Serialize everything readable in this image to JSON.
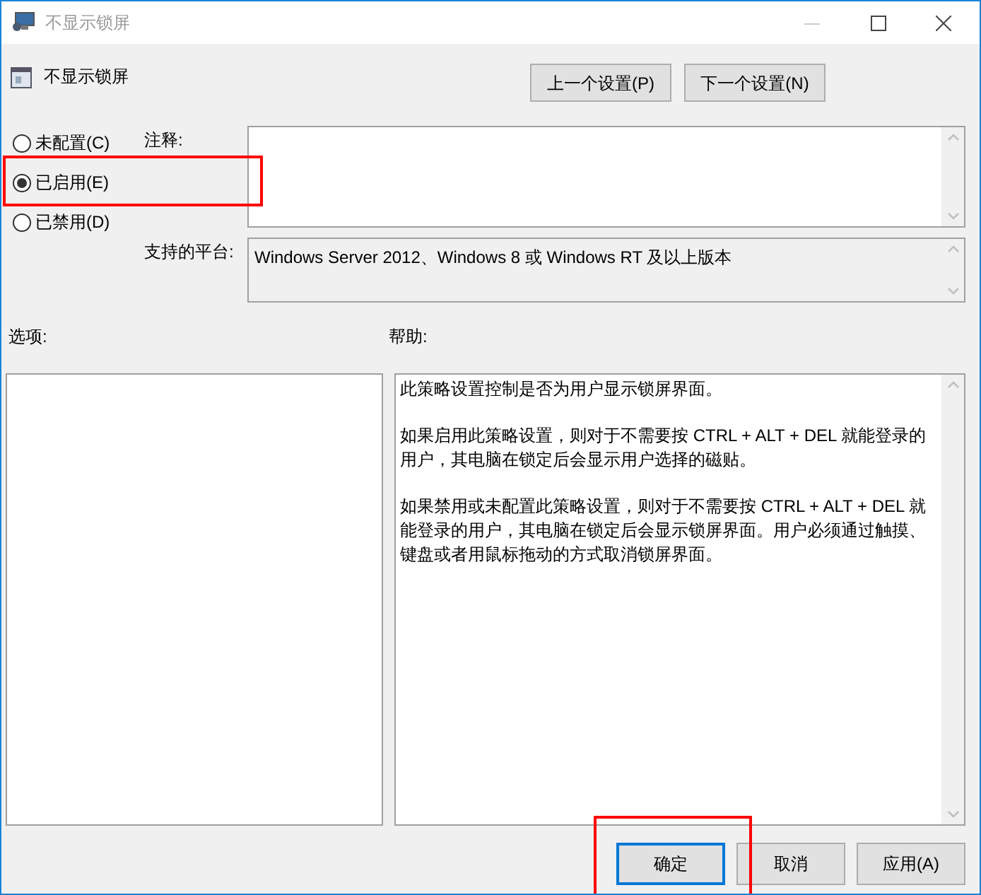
{
  "window": {
    "title": "不显示锁屏"
  },
  "policy_name": "不显示锁屏",
  "nav_buttons": [
    "上一个设置(P)",
    "下一个设置(N)"
  ],
  "options": [
    {
      "label": "未配置(C)",
      "selected": false
    },
    {
      "label": "已启用(E)",
      "selected": true
    },
    {
      "label": "已禁用(D)",
      "selected": false
    }
  ],
  "comment": {
    "label": "注释:"
  },
  "platform": {
    "label": "支持的平台:",
    "value": "Windows Server 2012、Windows 8 或 Windows RT 及以上版本"
  },
  "options_label": "选项:",
  "help_label": "帮助:",
  "help_paragraphs": [
    "此策略设置控制是否为用户显示锁屏界面。",
    "如果启用此策略设置，则对于不需要按 CTRL + ALT + DEL  就能登录的用户，其电脑在锁定后会显示用户选择的磁贴。",
    "如果禁用或未配置此策略设置，则对于不需要按 CTRL + ALT + DEL 就能登录的用户，其电脑在锁定后会显示锁屏界面。用户必须通过触摸、键盘或者用鼠标拖动的方式取消锁屏界面。"
  ],
  "buttons": [
    "确定",
    "取消",
    "应用(A)"
  ]
}
